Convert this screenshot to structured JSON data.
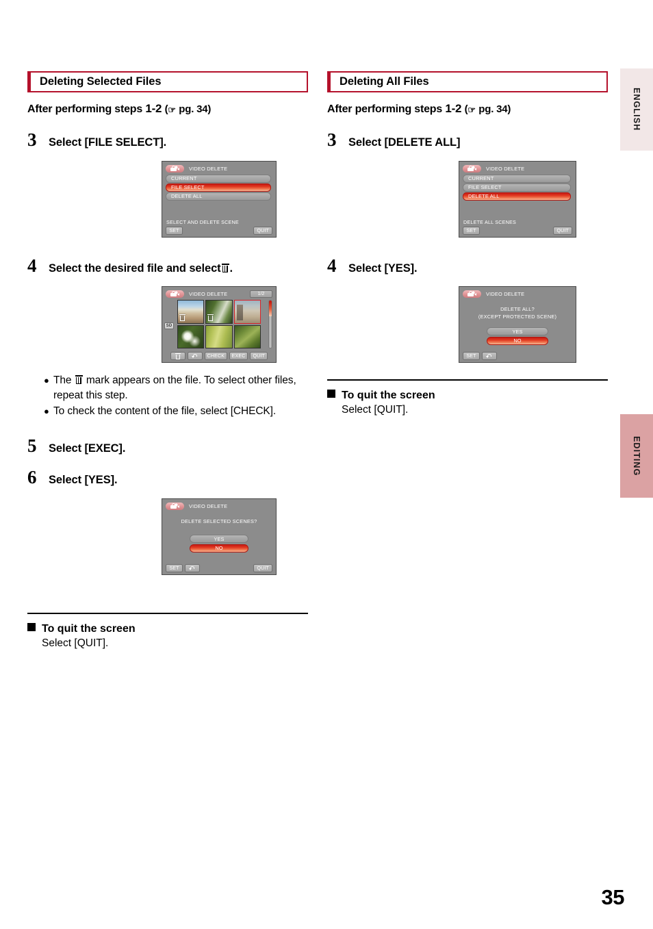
{
  "page": {
    "number": "35",
    "side_tabs": [
      {
        "label": "ENGLISH",
        "color": "#f2e7e7"
      },
      {
        "label": "EDITING",
        "color": "#dba2a3"
      }
    ]
  },
  "left_column": {
    "section_title": "Deleting Selected Files",
    "after_line": {
      "prefix": "After performing steps",
      "steps": "1-2",
      "open_paren": "(",
      "hand_icon": "pointing-hand-icon",
      "page_ref": "pg. 34",
      "close_paren": ")"
    },
    "steps": [
      {
        "num": "3",
        "text": "Select [FILE SELECT]."
      },
      {
        "num": "4",
        "text_before": "Select the desired file and select",
        "trash_icon": "trash-icon",
        "text_after": "."
      },
      {
        "num": "5",
        "text": "Select [EXEC]."
      },
      {
        "num": "6",
        "text": "Select [YES]."
      }
    ],
    "screen_menu": {
      "title": "VIDEO DELETE",
      "icon": "camcorder-icon",
      "rows": [
        {
          "label": "CURRENT",
          "selected": false
        },
        {
          "label": "FILE SELECT",
          "selected": true
        },
        {
          "label": "DELETE ALL",
          "selected": false
        }
      ],
      "caption": "SELECT AND DELETE SCENE",
      "buttons": [
        {
          "label": "SET"
        },
        {
          "label": "QUIT"
        }
      ]
    },
    "screen_thumbs": {
      "title": "VIDEO DELETE",
      "icon": "camcorder-icon",
      "page_chip": "1/2",
      "sd_badge": "SD",
      "thumbnails": [
        {
          "scene": "beach",
          "marked": true,
          "selected": false
        },
        {
          "scene": "forest",
          "marked": true,
          "selected": false
        },
        {
          "scene": "building",
          "marked": false,
          "selected": true
        },
        {
          "scene": "flower",
          "marked": false,
          "selected": false
        },
        {
          "scene": "grass",
          "marked": false,
          "selected": false
        },
        {
          "scene": "leaves",
          "marked": false,
          "selected": false
        }
      ],
      "buttons": [
        {
          "label": "",
          "icon": "trash-icon"
        },
        {
          "label": "",
          "icon": "back-arrow-icon"
        },
        {
          "label": "CHECK"
        },
        {
          "label": "EXEC"
        },
        {
          "label": "QUIT"
        }
      ]
    },
    "screen_confirm": {
      "title": "VIDEO DELETE",
      "icon": "camcorder-icon",
      "prompt": "DELETE SELECTED SCENES?",
      "options": [
        {
          "label": "YES",
          "selected": false
        },
        {
          "label": "NO",
          "selected": true
        }
      ],
      "buttons": [
        {
          "label": "SET"
        },
        {
          "label": "",
          "icon": "back-arrow-icon"
        },
        {
          "label": "QUIT"
        }
      ]
    },
    "bullets": [
      {
        "before": "The",
        "icon": "trash-icon",
        "after": "mark appears on the file. To select other files, repeat this step."
      },
      {
        "text": "To check the content of the file, select [CHECK]."
      }
    ],
    "quit": {
      "heading": "To quit the screen",
      "body": "Select [QUIT]."
    }
  },
  "right_column": {
    "section_title": "Deleting All Files",
    "after_line": {
      "prefix": "After performing steps",
      "steps": "1-2",
      "open_paren": "(",
      "hand_icon": "pointing-hand-icon",
      "page_ref": "pg. 34",
      "close_paren": ")"
    },
    "steps": [
      {
        "num": "3",
        "text": "Select [DELETE ALL]"
      },
      {
        "num": "4",
        "text": "Select [YES]."
      }
    ],
    "screen_menu": {
      "title": "VIDEO DELETE",
      "icon": "camcorder-icon",
      "rows": [
        {
          "label": "CURRENT",
          "selected": false
        },
        {
          "label": "FILE SELECT",
          "selected": false
        },
        {
          "label": "DELETE ALL",
          "selected": true
        }
      ],
      "caption": "DELETE ALL SCENES",
      "buttons": [
        {
          "label": "SET"
        },
        {
          "label": "QUIT"
        }
      ]
    },
    "screen_confirm": {
      "title": "VIDEO DELETE",
      "icon": "camcorder-icon",
      "prompt_line1": "DELETE ALL?",
      "prompt_line2": "(EXCEPT PROTECTED SCENE)",
      "options": [
        {
          "label": "YES",
          "selected": false
        },
        {
          "label": "NO",
          "selected": true
        }
      ],
      "buttons": [
        {
          "label": "SET"
        },
        {
          "label": "",
          "icon": "back-arrow-icon"
        }
      ]
    },
    "quit": {
      "heading": "To quit the screen",
      "body": "Select [QUIT]."
    }
  }
}
